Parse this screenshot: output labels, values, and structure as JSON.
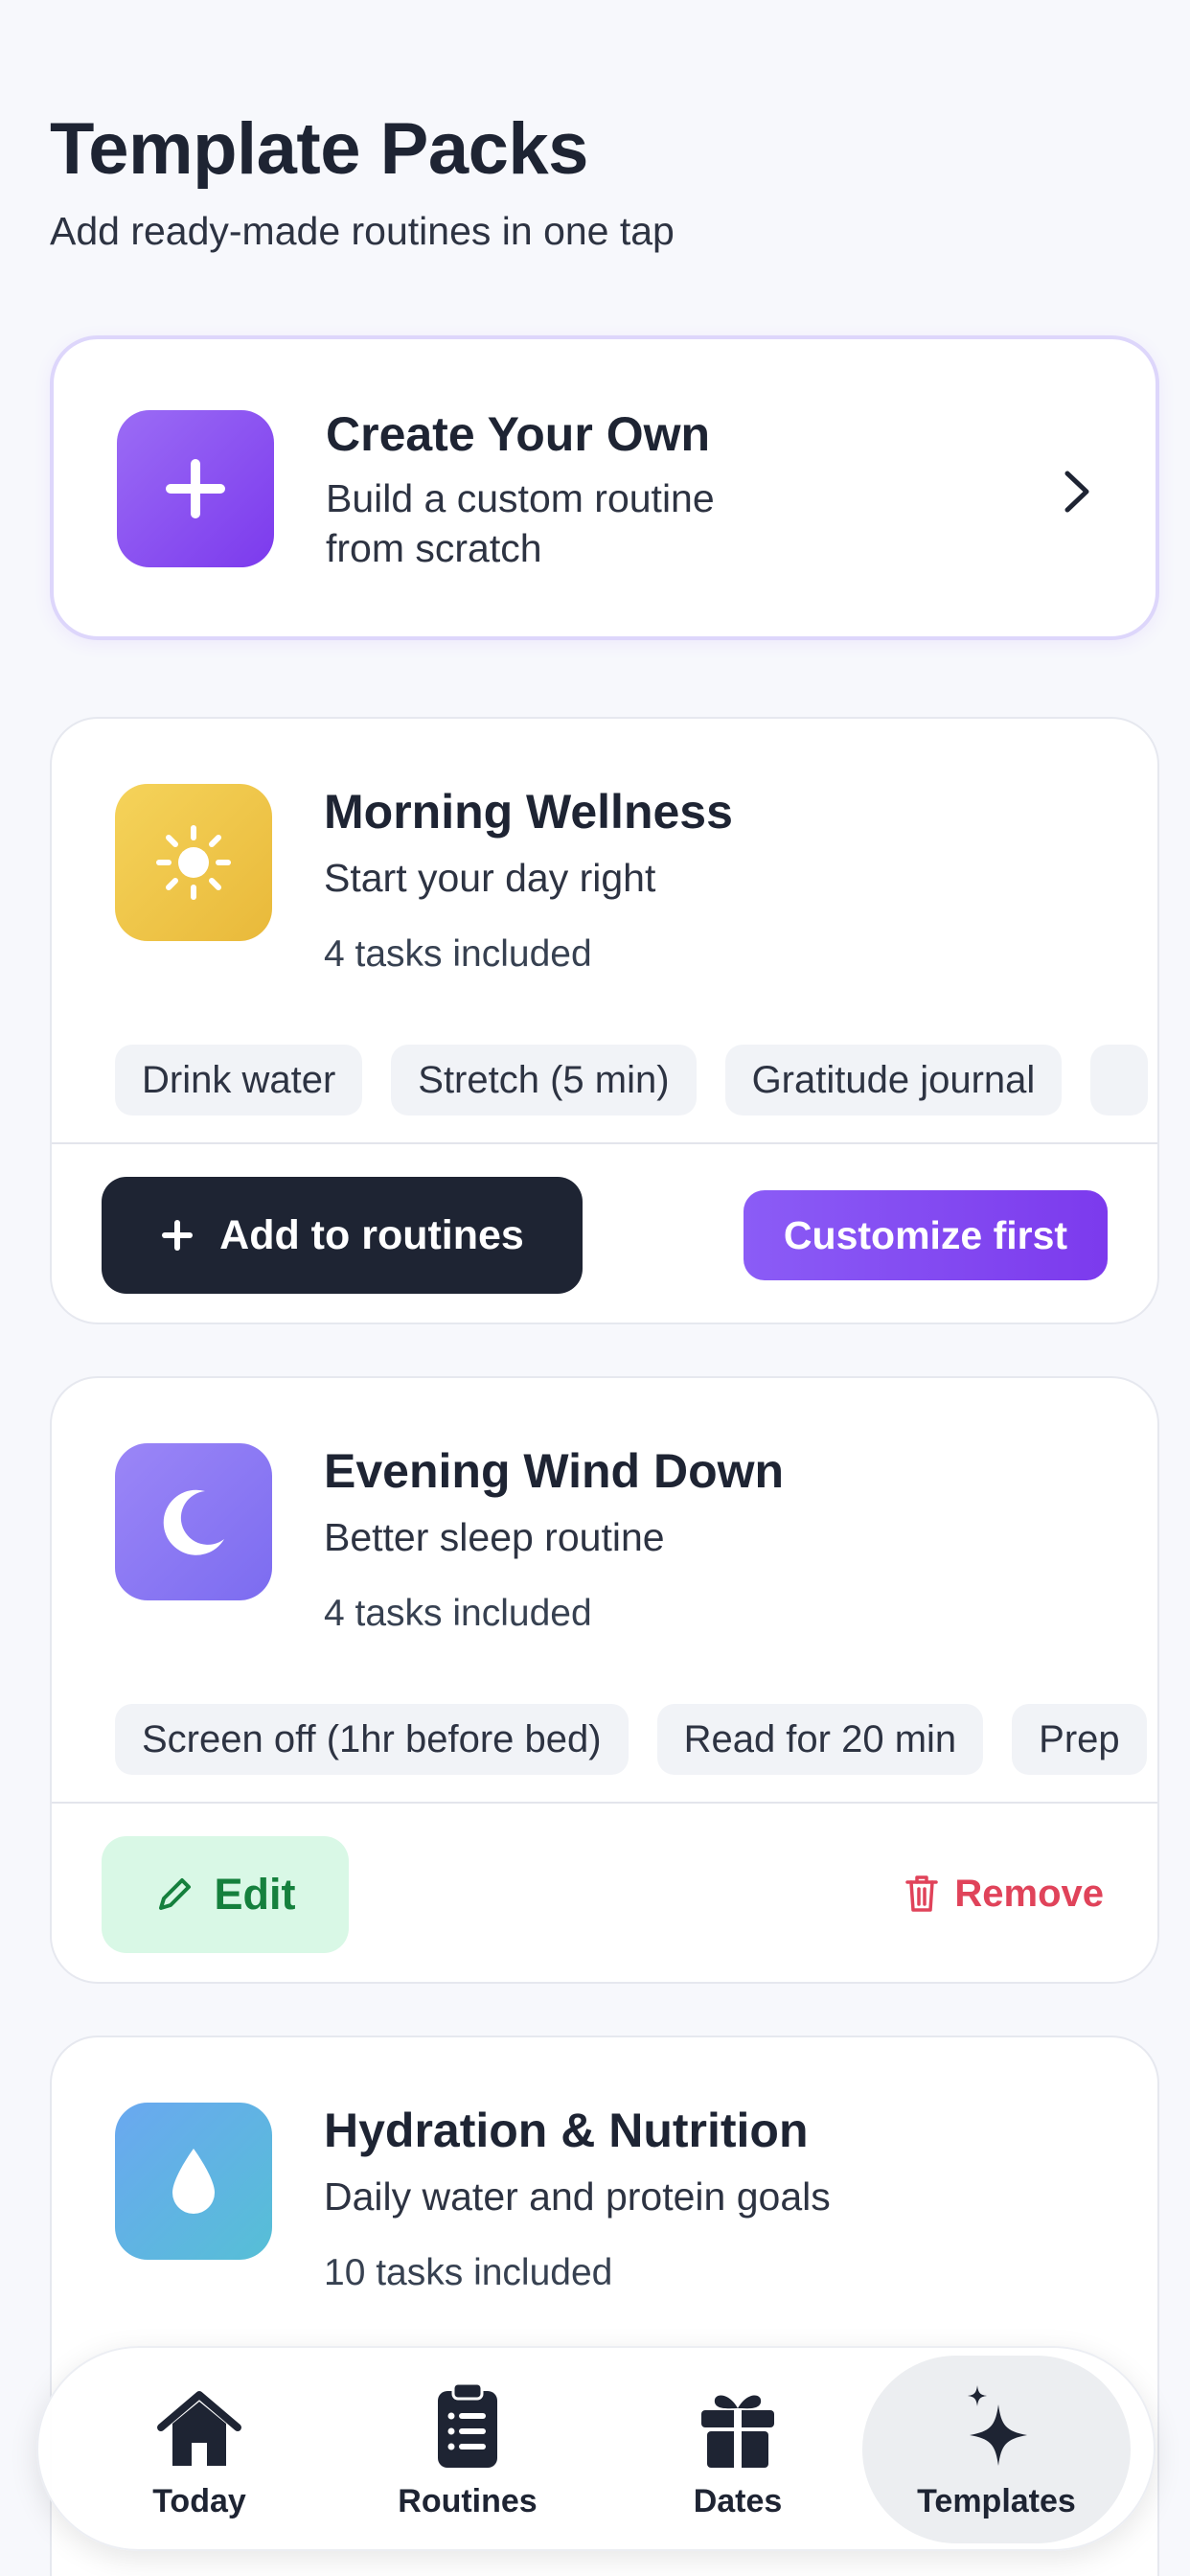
{
  "header": {
    "title": "Template Packs",
    "subtitle": "Add ready-made routines in one tap"
  },
  "create_card": {
    "title": "Create Your Own",
    "desc_line1": "Build a custom routine",
    "desc_line2": "from scratch",
    "icon": "plus-icon",
    "accent": "#8b5cf6"
  },
  "packs": [
    {
      "title": "Morning Wellness",
      "desc": "Start your day right",
      "count": "4 tasks included",
      "icon": "sun-icon",
      "color": "#f2c94c",
      "chips": [
        "Drink water",
        "Stretch (5 min)",
        "Gratitude journal"
      ],
      "primary_action": "Add to routines",
      "secondary_action": "Customize first"
    },
    {
      "title": "Evening Wind Down",
      "desc": "Better sleep routine",
      "count": "4 tasks included",
      "icon": "moon-icon",
      "color": "#8b7cf6",
      "chips": [
        "Screen off (1hr before bed)",
        "Read for 20 min",
        "Prep"
      ],
      "edit_action": "Edit",
      "remove_action": "Remove"
    },
    {
      "title": "Hydration & Nutrition",
      "desc": "Daily water and protein goals",
      "count": "10 tasks included",
      "icon": "water-drop-icon",
      "color": "#5aa9e6"
    }
  ],
  "tabbar": {
    "tabs": [
      {
        "label": "Today",
        "icon": "home-icon"
      },
      {
        "label": "Routines",
        "icon": "clipboard-icon"
      },
      {
        "label": "Dates",
        "icon": "gift-icon"
      },
      {
        "label": "Templates",
        "icon": "sparkles-icon",
        "active": true
      }
    ]
  },
  "colors": {
    "background": "#f7f8fc",
    "dark_button": "#1e2433",
    "purple_button": "#7c3aed",
    "edit_bg": "#d9f8e6",
    "remove_red": "#e0435a"
  }
}
